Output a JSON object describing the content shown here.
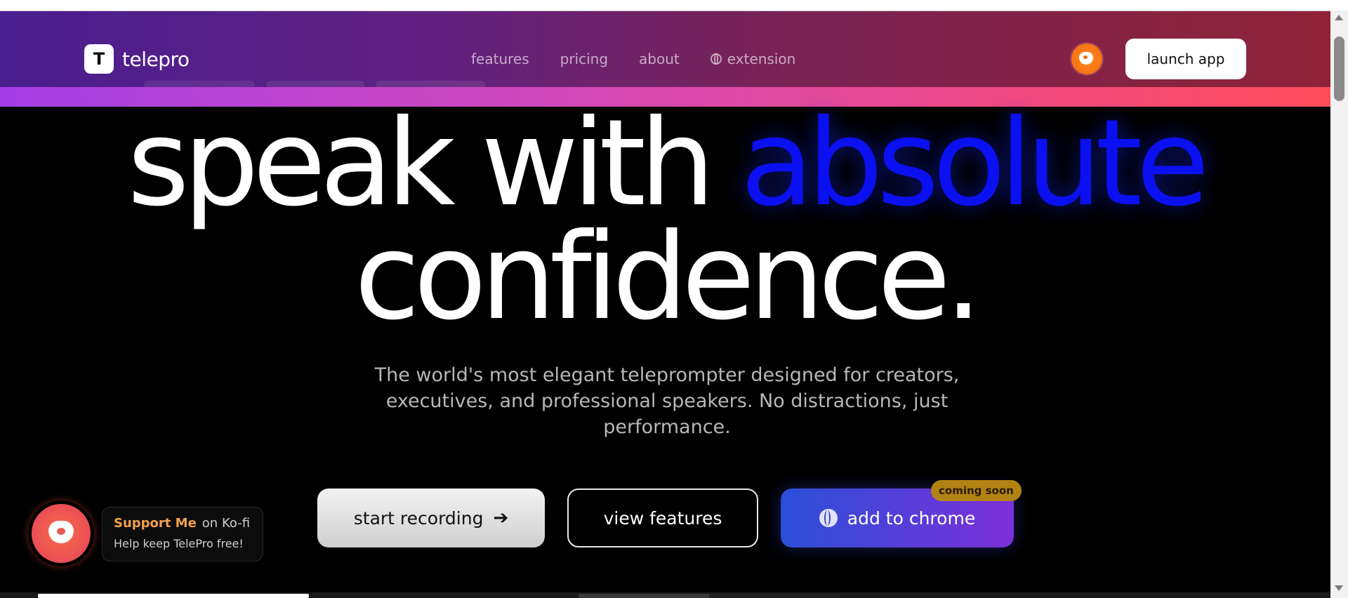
{
  "header": {
    "logo_letter": "T",
    "brand": "telepro",
    "nav": [
      {
        "label": "features"
      },
      {
        "label": "pricing"
      },
      {
        "label": "about"
      },
      {
        "label": "extension",
        "icon": "globe-icon"
      }
    ],
    "launch_label": "launch app"
  },
  "hero": {
    "line1_a": "speak with ",
    "line1_b": "absolute",
    "line2": "confidence.",
    "subtitle": "The world's most elegant teleprompter designed for creators, executives, and professional speakers. No distractions, just performance."
  },
  "cta": {
    "start_label": "start recording",
    "start_icon": "arrow-right-icon",
    "view_label": "view features",
    "chrome_label": "add to chrome",
    "chrome_icon": "globe-icon",
    "badge": "coming soon"
  },
  "kofi": {
    "support": "Support Me",
    "on": "on Ko-fi",
    "tagline": "Help keep TelePro free!"
  },
  "colors": {
    "accent_blue": "#0a10f0",
    "header_gradient": [
      "#4a1e8e",
      "#8e2338"
    ],
    "accent_bar": [
      "#a43fe6",
      "#ff4c5b"
    ],
    "badge": "#b28313"
  }
}
